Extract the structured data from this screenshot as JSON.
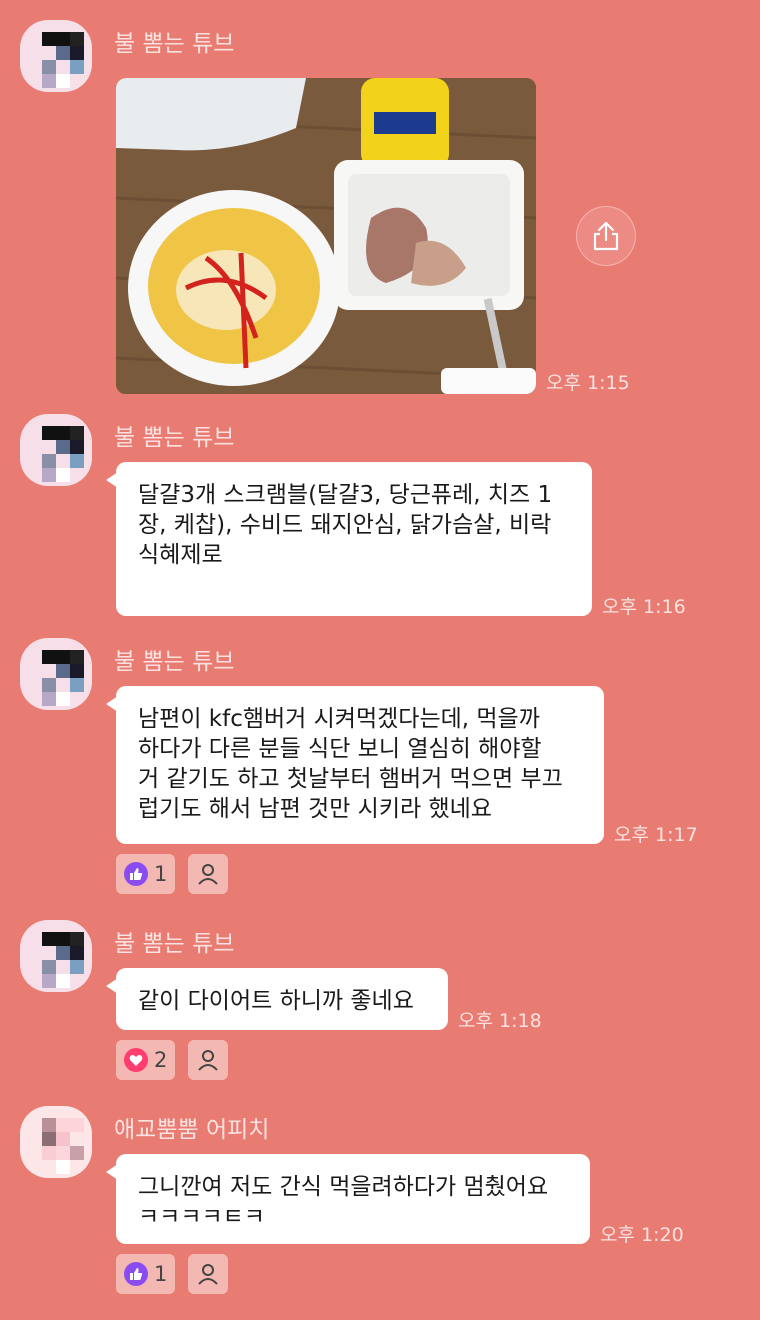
{
  "colors": {
    "background": "#e97c72",
    "bubble": "#ffffff",
    "reaction_bg": "#f4b8b3",
    "like": "#8a4cf0",
    "heart": "#ff3d6e"
  },
  "messages": [
    {
      "sender": "불 뽐는 튜브",
      "type": "image",
      "time": "오후 1:15",
      "image_icon": "photo-of-scrambled-eggs-and-pork"
    },
    {
      "sender": "불 뽐는 튜브",
      "type": "text",
      "lines": [
        "달걀3개 스크램블(달걀3, 당근퓨레, 치즈 1",
        "장, 케찹), 수비드 돼지안심, 닭가슴살, 비락",
        "식혜제로"
      ],
      "time": "오후 1:16"
    },
    {
      "sender": "불 뽐는 튜브",
      "type": "text",
      "lines": [
        "남편이 kfc햄버거 시켜먹겠다는데, 먹을까",
        "하다가 다른 분들 식단 보니 열심히 해야할",
        "거 같기도 하고 첫날부터 햄버거 먹으면 부끄",
        "럽기도 해서 남편 것만 시키라 했네요"
      ],
      "time": "오후 1:17",
      "reaction": {
        "icon": "thumbs-up-icon",
        "count": "1"
      }
    },
    {
      "sender": "불 뽐는 튜브",
      "type": "text",
      "lines": [
        "같이 다이어트 하니까 좋네요"
      ],
      "time": "오후 1:18",
      "reaction": {
        "icon": "heart-icon",
        "count": "2"
      }
    },
    {
      "sender": "애교뿜뿜 어피치",
      "type": "text",
      "lines": [
        "그니깐여 저도 간식 먹을려하다가 멈췄어요",
        "ㅋㅋㅋㅋㅌㅋ"
      ],
      "time": "오후 1:20",
      "reaction": {
        "icon": "thumbs-up-icon",
        "count": "1"
      }
    }
  ]
}
